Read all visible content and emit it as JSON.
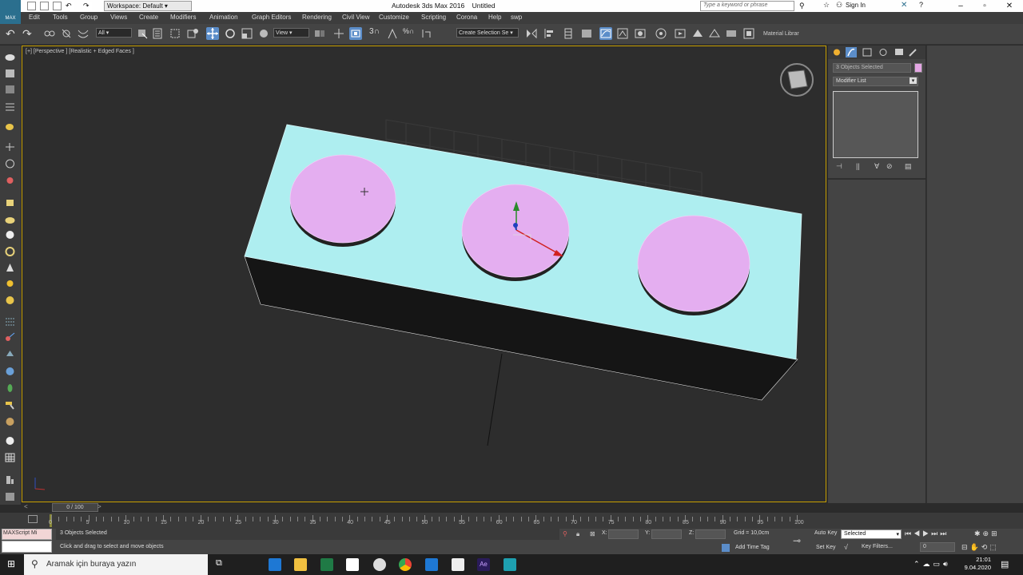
{
  "titlebar": {
    "workspace": "Workspace: Default",
    "app_title": "Autodesk 3ds Max 2016",
    "doc_title": "Untitled",
    "search_placeholder": "Type a keyword or phrase",
    "sign_in": "Sign In",
    "logo_text": "MAX"
  },
  "menu": [
    "Edit",
    "Tools",
    "Group",
    "Views",
    "Create",
    "Modifiers",
    "Animation",
    "Graph Editors",
    "Rendering",
    "Civil View",
    "Customize",
    "Scripting",
    "Corona",
    "Help",
    "swp"
  ],
  "toolbar": {
    "filter_value": "All",
    "ref_coord": "View",
    "named_selection": "Create Selection Se",
    "snap_label": "3",
    "material_library": "Material Librar"
  },
  "viewport": {
    "label": "[+] [Perspective ] [Realistic + Edged Faces ]",
    "box_color": "#aeeef0",
    "cylinder_color": "#e4aef0"
  },
  "command_panel": {
    "selection": "3 Objects Selected",
    "modifier_list": "Modifier List",
    "object_color": "#e4a6e4"
  },
  "time_slider": {
    "frame_display": "0 / 100"
  },
  "ruler_labels": [
    "0",
    "5",
    "10",
    "15",
    "20",
    "25",
    "30",
    "35",
    "40",
    "45",
    "50",
    "55",
    "60",
    "65",
    "70",
    "75",
    "80",
    "85",
    "90",
    "95",
    "100"
  ],
  "status": {
    "maxscript_label": "MAXScript Mi",
    "selection_text": "3 Objects Selected",
    "prompt_text": "Click and drag to select and move objects",
    "x_label": "X:",
    "y_label": "Y:",
    "z_label": "Z:",
    "grid": "Grid = 10,0cm",
    "add_time_tag": "Add Time Tag",
    "auto_key": "Auto Key",
    "set_key": "Set Key",
    "selected_dropdown": "Selected",
    "key_filters": "Key Filters...",
    "current_frame": "0"
  },
  "taskbar": {
    "search_placeholder": "Aramak için buraya yazın",
    "time": "21:01",
    "date": "9.04.2020"
  }
}
